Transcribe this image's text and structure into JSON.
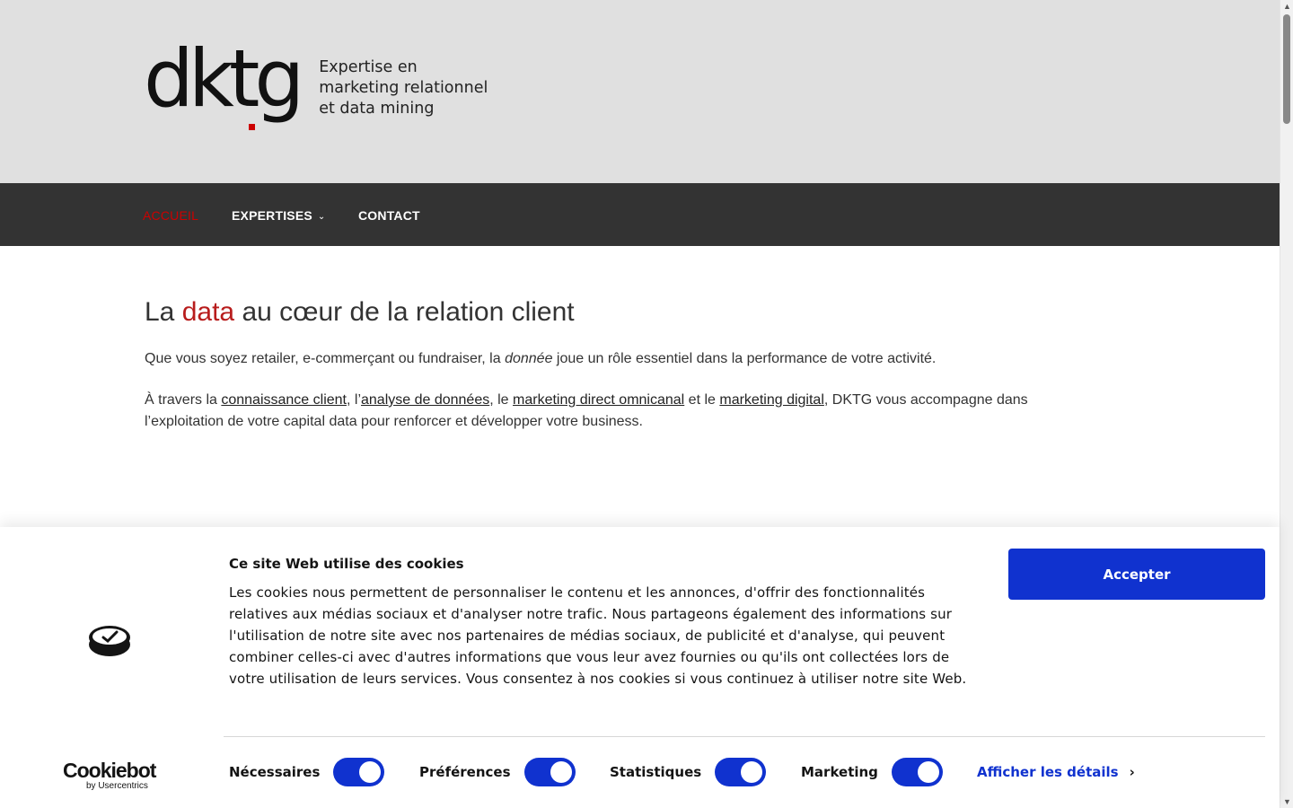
{
  "header": {
    "logo_text": "dktg",
    "tagline": [
      "Expertise en",
      "marketing relationnel",
      "et data mining"
    ]
  },
  "nav": {
    "items": [
      {
        "label": "ACCUEIL",
        "active": true
      },
      {
        "label": "EXPERTISES",
        "has_dropdown": true
      },
      {
        "label": "CONTACT"
      }
    ]
  },
  "main": {
    "title_prefix": "La ",
    "title_accent": "data",
    "title_suffix": " au cœur de la relation client",
    "p1_before": "Que vous soyez retailer, e-commerçant ou fundraiser, la ",
    "p1_em": "donnée",
    "p1_after": " joue un rôle essentiel dans la performance de votre activité.",
    "p2_start": "À travers la ",
    "p2_link1": "connaissance client",
    "p2_sep1": ", l’",
    "p2_link2": "analyse de données",
    "p2_sep2": ", le ",
    "p2_link3": "marketing direct omnicanal",
    "p2_sep3": " et le ",
    "p2_link4": "marketing digital",
    "p2_end": ", DKTG vous accompagne dans l’exploitation de votre capital data pour renforcer et développer votre business."
  },
  "cookie_banner": {
    "brand_name": "Cookiebot",
    "brand_by": "by Usercentrics",
    "title": "Ce site Web utilise des cookies",
    "text": "Les cookies nous permettent de personnaliser le contenu et les annonces, d'offrir des fonctionnalités relatives aux médias sociaux et d'analyser notre trafic. Nous partageons également des informations sur l'utilisation de notre site avec nos partenaires de médias sociaux, de publicité et d'analyse, qui peuvent combiner celles-ci avec d'autres informations que vous leur avez fournies ou qu'ils ont collectées lors de votre utilisation de leurs services. Vous consentez à nos cookies si vous continuez à utiliser notre site Web.",
    "accept_label": "Accepter",
    "consents": [
      {
        "label": "Nécessaires",
        "checked": true
      },
      {
        "label": "Préférences",
        "checked": true
      },
      {
        "label": "Statistiques",
        "checked": true
      },
      {
        "label": "Marketing",
        "checked": true
      }
    ],
    "details_label": "Afficher les détails"
  },
  "colors": {
    "accent_red": "#c00000",
    "cookie_blue": "#1032cf",
    "nav_bg": "#333333",
    "header_bg": "#e0e0e0"
  }
}
